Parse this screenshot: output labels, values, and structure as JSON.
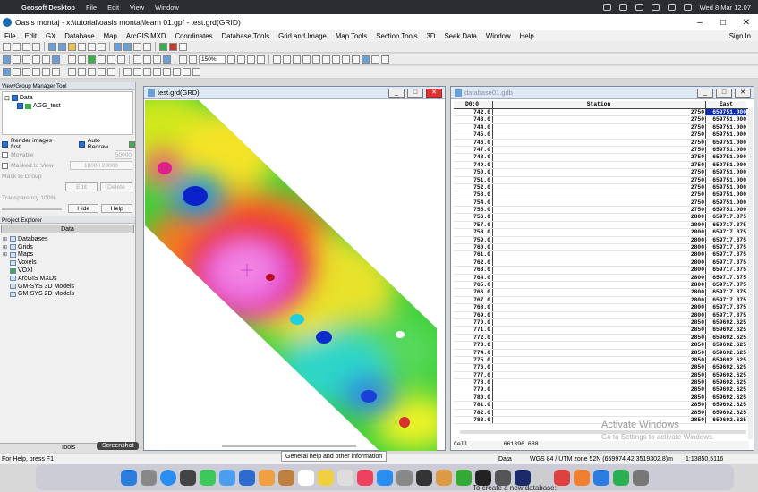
{
  "mac_menu": {
    "app": "Geosoft Desktop",
    "items": [
      "File",
      "Edit",
      "View",
      "Window"
    ],
    "clock": "Wed 8 Mar 12.07"
  },
  "window": {
    "title": "Oasis montaj - x:\\tutorial\\oasis montaj\\learn 01.gpf - test.grd(GRID)"
  },
  "menu": {
    "items": [
      "File",
      "Edit",
      "GX",
      "Database",
      "Map",
      "ArcGIS MXD",
      "Coordinates",
      "Database Tools",
      "Grid and Image",
      "Map Tools",
      "Section Tools",
      "3D",
      "Seek Data",
      "Window",
      "Help"
    ],
    "sign_in": "Sign In"
  },
  "toolbar": {
    "zoom": "150%"
  },
  "view_group_manager": {
    "title": "View/Group Manager Tool",
    "tree": {
      "root": "Data",
      "child": "AGG_test"
    },
    "render_images_first": "Render images first",
    "auto_redraw": "Auto Redraw",
    "movable": "Movable",
    "masked_to_view": "Masked to View",
    "mask_to_group": "Mask to Group",
    "scale_value": "50000",
    "range_value": "10000 20000",
    "edit": "Edit",
    "delete": "Delete",
    "transparency": "Transparency 100%",
    "hide": "Hide",
    "help": "Help"
  },
  "project_explorer": {
    "title": "Project Explorer",
    "tab": "Data",
    "items": [
      "Databases",
      "Grids",
      "Maps",
      "Voxels",
      "VOXI",
      "ArcGIS MXDs",
      "GM-SYS 3D Models",
      "GM-SYS 2D Models"
    ],
    "tools": "Tools"
  },
  "grid_window": {
    "title": "test.grd(GRD)"
  },
  "db_window": {
    "title": "database01.gdb",
    "columns": [
      "D0:0",
      "Station",
      "East"
    ],
    "rows": [
      [
        "742.0",
        "2750",
        "659751.000"
      ],
      [
        "743.0",
        "2750",
        "659751.000"
      ],
      [
        "744.0",
        "2750",
        "659751.000"
      ],
      [
        "745.0",
        "2750",
        "659751.000"
      ],
      [
        "746.0",
        "2750",
        "659751.000"
      ],
      [
        "747.0",
        "2750",
        "659751.000"
      ],
      [
        "748.0",
        "2750",
        "659751.000"
      ],
      [
        "749.0",
        "2750",
        "659751.000"
      ],
      [
        "750.0",
        "2750",
        "659751.000"
      ],
      [
        "751.0",
        "2750",
        "659751.000"
      ],
      [
        "752.0",
        "2750",
        "659751.000"
      ],
      [
        "753.0",
        "2750",
        "659751.000"
      ],
      [
        "754.0",
        "2750",
        "659751.000"
      ],
      [
        "755.0",
        "2750",
        "659751.000"
      ],
      [
        "756.0",
        "2800",
        "659717.375"
      ],
      [
        "757.0",
        "2800",
        "659717.375"
      ],
      [
        "758.0",
        "2800",
        "659717.375"
      ],
      [
        "759.0",
        "2800",
        "659717.375"
      ],
      [
        "760.0",
        "2800",
        "659717.375"
      ],
      [
        "761.0",
        "2800",
        "659717.375"
      ],
      [
        "762.0",
        "2800",
        "659717.375"
      ],
      [
        "763.0",
        "2800",
        "659717.375"
      ],
      [
        "764.0",
        "2800",
        "659717.375"
      ],
      [
        "765.0",
        "2800",
        "659717.375"
      ],
      [
        "766.0",
        "2800",
        "659717.375"
      ],
      [
        "767.0",
        "2800",
        "659717.375"
      ],
      [
        "768.0",
        "2800",
        "659717.375"
      ],
      [
        "769.0",
        "2800",
        "659717.375"
      ],
      [
        "770.0",
        "2850",
        "659692.625"
      ],
      [
        "771.0",
        "2850",
        "659692.625"
      ],
      [
        "772.0",
        "2850",
        "659692.625"
      ],
      [
        "773.0",
        "2850",
        "659692.625"
      ],
      [
        "774.0",
        "2850",
        "659692.625"
      ],
      [
        "775.0",
        "2850",
        "659692.625"
      ],
      [
        "776.0",
        "2850",
        "659692.625"
      ],
      [
        "777.0",
        "2850",
        "659692.625"
      ],
      [
        "778.0",
        "2850",
        "659692.625"
      ],
      [
        "779.0",
        "2850",
        "659692.625"
      ],
      [
        "780.0",
        "2850",
        "659692.625"
      ],
      [
        "781.0",
        "2850",
        "659692.625"
      ],
      [
        "782.0",
        "2850",
        "659692.625"
      ],
      [
        "783.0",
        "2850",
        "659692.625"
      ]
    ],
    "selected_value": "659751.000",
    "cell_label": "Cell",
    "cell_value": "661396.688"
  },
  "watermark": {
    "line1": "Activate Windows",
    "line2": "Go to Settings to activate Windows."
  },
  "status": {
    "left": "For Help, press F1",
    "data": "Data",
    "coords": "WGS 84 / UTM zone 52N  (659974.42,3519302.8)m",
    "scale": "1:13850.5116"
  },
  "tooltip": "General help and other information",
  "screenshot_label": "Screenshot",
  "peek_text": "To create a new database:"
}
